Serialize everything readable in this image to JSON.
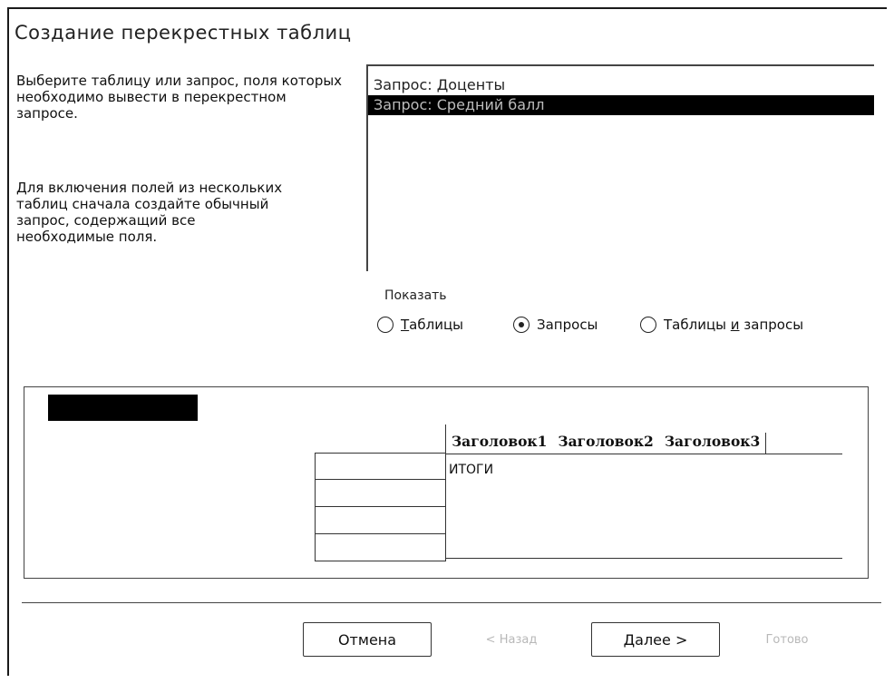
{
  "dialog": {
    "title": "Создание перекрестных таблиц",
    "description_1": "Выберите таблицу или запрос, поля которых необходимо вывести в перекрестном запросе.",
    "description_2": "Для включения полей из нескольких таблиц сначала создайте обычный запрос, содержащий все необходимые поля."
  },
  "list": {
    "items": [
      {
        "label": "Запрос: Доценты",
        "selected": false
      },
      {
        "label": "Запрос: Средний балл",
        "selected": true
      }
    ]
  },
  "show": {
    "label": "Показать",
    "options": [
      {
        "prefix": "",
        "underline": "Т",
        "suffix": "аблицы",
        "checked": false
      },
      {
        "prefix": "Запросы",
        "underline": "",
        "suffix": "",
        "checked": true
      },
      {
        "prefix": "Таблицы ",
        "underline": "и",
        "suffix": " запросы",
        "checked": false
      }
    ]
  },
  "preview": {
    "headers": [
      "Заголовок1",
      "Заголовок2",
      "Заголовок3"
    ],
    "totals_label": "ИТОГИ",
    "row_count": 4
  },
  "buttons": {
    "cancel": "Отмена",
    "back": "< Назад",
    "next": "Далее >",
    "finish": "Готово"
  }
}
